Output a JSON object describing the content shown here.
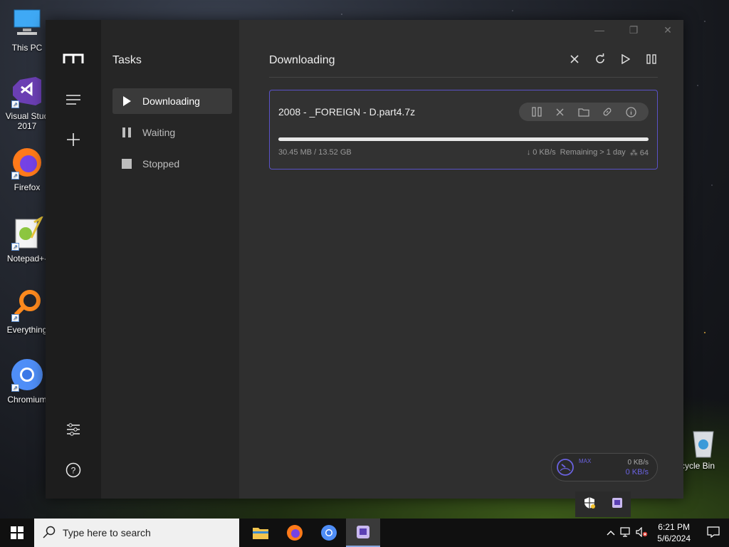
{
  "desktop": {
    "icons": [
      {
        "label": "This PC"
      },
      {
        "label": "Visual Stud 2017"
      },
      {
        "label": "Firefox"
      },
      {
        "label": "Notepad+-"
      },
      {
        "label": "Everything"
      },
      {
        "label": "Chromium"
      }
    ],
    "recycle_bin": "cycle Bin"
  },
  "sidebar": {
    "title": "Tasks",
    "items": [
      {
        "label": "Downloading",
        "icon": "play-icon",
        "active": true
      },
      {
        "label": "Waiting",
        "icon": "pause-icon",
        "active": false
      },
      {
        "label": "Stopped",
        "icon": "stop-icon",
        "active": false
      }
    ]
  },
  "main": {
    "title": "Downloading",
    "task": {
      "name": "2008 - _FOREIGN - D.part4.7z",
      "progress": 1.0,
      "size": "30.45 MB / 13.52 GB",
      "speed": "↓ 0 KB/s",
      "remaining": "Remaining > 1 day",
      "connections": "64"
    },
    "speed_widget": {
      "mini": "MAX",
      "upload": "0 KB/s",
      "download": "0 KB/s"
    }
  },
  "taskbar": {
    "search_placeholder": "Type here to search",
    "time": "6:21 PM",
    "date": "5/6/2024"
  },
  "colors": {
    "accent": "#5a52c8",
    "speed_down": "#6a62e0"
  }
}
